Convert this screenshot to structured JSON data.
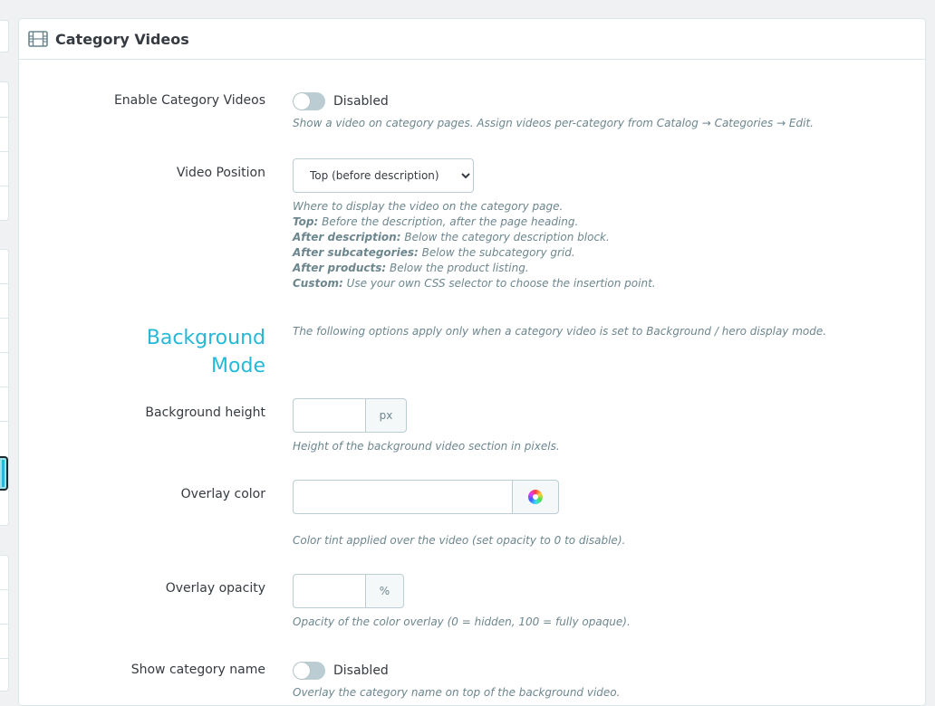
{
  "panel": {
    "title": "Category Videos",
    "icon": "film-icon"
  },
  "enable_videos": {
    "label": "Enable Category Videos",
    "state": "Disabled",
    "help": "Show a video on category pages. Assign videos per-category from Catalog → Categories → Edit."
  },
  "video_position": {
    "label": "Video Position",
    "selected": "Top (before description)",
    "help_intro": "Where to display the video on the category page.",
    "options_help": [
      {
        "term": "Top:",
        "text": " Before the description, after the page heading."
      },
      {
        "term": "After description:",
        "text": " Below the category description block."
      },
      {
        "term": "After subcategories:",
        "text": " Below the subcategory grid."
      },
      {
        "term": "After products:",
        "text": " Below the product listing."
      },
      {
        "term": "Custom:",
        "text": " Use your own CSS selector to choose the insertion point."
      }
    ]
  },
  "background_mode": {
    "title_line1": "Background",
    "title_line2": "Mode",
    "help": "The following options apply only when a category video is set to Background / hero display mode."
  },
  "background_height": {
    "label": "Background height",
    "value": "",
    "unit": "px",
    "help": "Height of the background video section in pixels."
  },
  "overlay_color": {
    "label": "Overlay color",
    "value": "",
    "help": "Color tint applied over the video (set opacity to 0 to disable)."
  },
  "overlay_opacity": {
    "label": "Overlay opacity",
    "value": "",
    "unit": "%",
    "help": "Opacity of the color overlay (0 = hidden, 100 = fully opaque)."
  },
  "show_category_name": {
    "label": "Show category name",
    "state": "Disabled",
    "help": "Overlay the category name on top of the background video."
  },
  "colors": {
    "accent": "#25b9d7",
    "border": "#bbcdd2",
    "help_text": "#6c868e"
  }
}
